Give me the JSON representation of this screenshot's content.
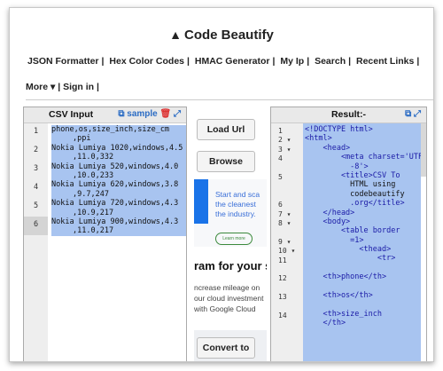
{
  "brand": {
    "name": "Code Beautify",
    "icon": "lightbulb-icon"
  },
  "nav": {
    "items": [
      "JSON Formatter",
      "Hex Color Codes",
      "HMAC Generator",
      "My Ip",
      "Search",
      "Recent Links"
    ],
    "more": "More",
    "signin": "Sign in"
  },
  "input_panel": {
    "title": "CSV Input",
    "sample_label": "sample",
    "line_numbers": [
      "1",
      "2",
      "3",
      "4",
      "5",
      "6"
    ],
    "lines": [
      [
        "phone,os,size_inch,size_cm",
        ",ppi"
      ],
      [
        "Nokia Lumiya 1020,windows,4.5",
        ",11.0,332"
      ],
      [
        "Nokia Lumiya 520,windows,4.0",
        ",10.0,233"
      ],
      [
        "Nokia Lumiya 620,windows,3.8",
        ",9.7,247"
      ],
      [
        "Nokia Lumiya 720,windows,4.3",
        ",10.9,217"
      ],
      [
        "Nokia Lumiya 900,windows,4.3",
        ",11.0,217"
      ]
    ]
  },
  "middle": {
    "load_url_label": "Load Url",
    "browse_label": "Browse",
    "convert_label": "Convert to",
    "ad_line1": "Start and sca",
    "ad_line2": "the cleanest",
    "ad_line3": "the industry.",
    "ad_pill": "Learn more",
    "ad_headline": "ram for your sta",
    "ad_body1": "ncrease mileage on",
    "ad_body2": "our cloud investment",
    "ad_body3": "with Google Cloud"
  },
  "result_panel": {
    "title": "Result:-",
    "gutter": [
      "1",
      "2 ▾",
      "3 ▾",
      "4",
      "",
      "5",
      "",
      "",
      "6",
      "7 ▾",
      "8 ▾",
      "",
      "9 ▾",
      "10 ▾",
      "11",
      "",
      "12",
      "",
      "13",
      "",
      "14"
    ],
    "lines": [
      "<!DOCTYPE html>",
      "<html>",
      "    <head>",
      "        <meta charset='UTF",
      "          -8'>",
      "        <title>CSV To",
      "          HTML using",
      "          codebeautify",
      "          .org</title>",
      "    </head>",
      "    <body>",
      "        <table border",
      "          =1>",
      "            <thead>",
      "                <tr>",
      "",
      "    <th>phone</th>",
      "",
      "    <th>os</th>",
      "",
      "    <th>size_inch",
      "    </th>"
    ]
  }
}
